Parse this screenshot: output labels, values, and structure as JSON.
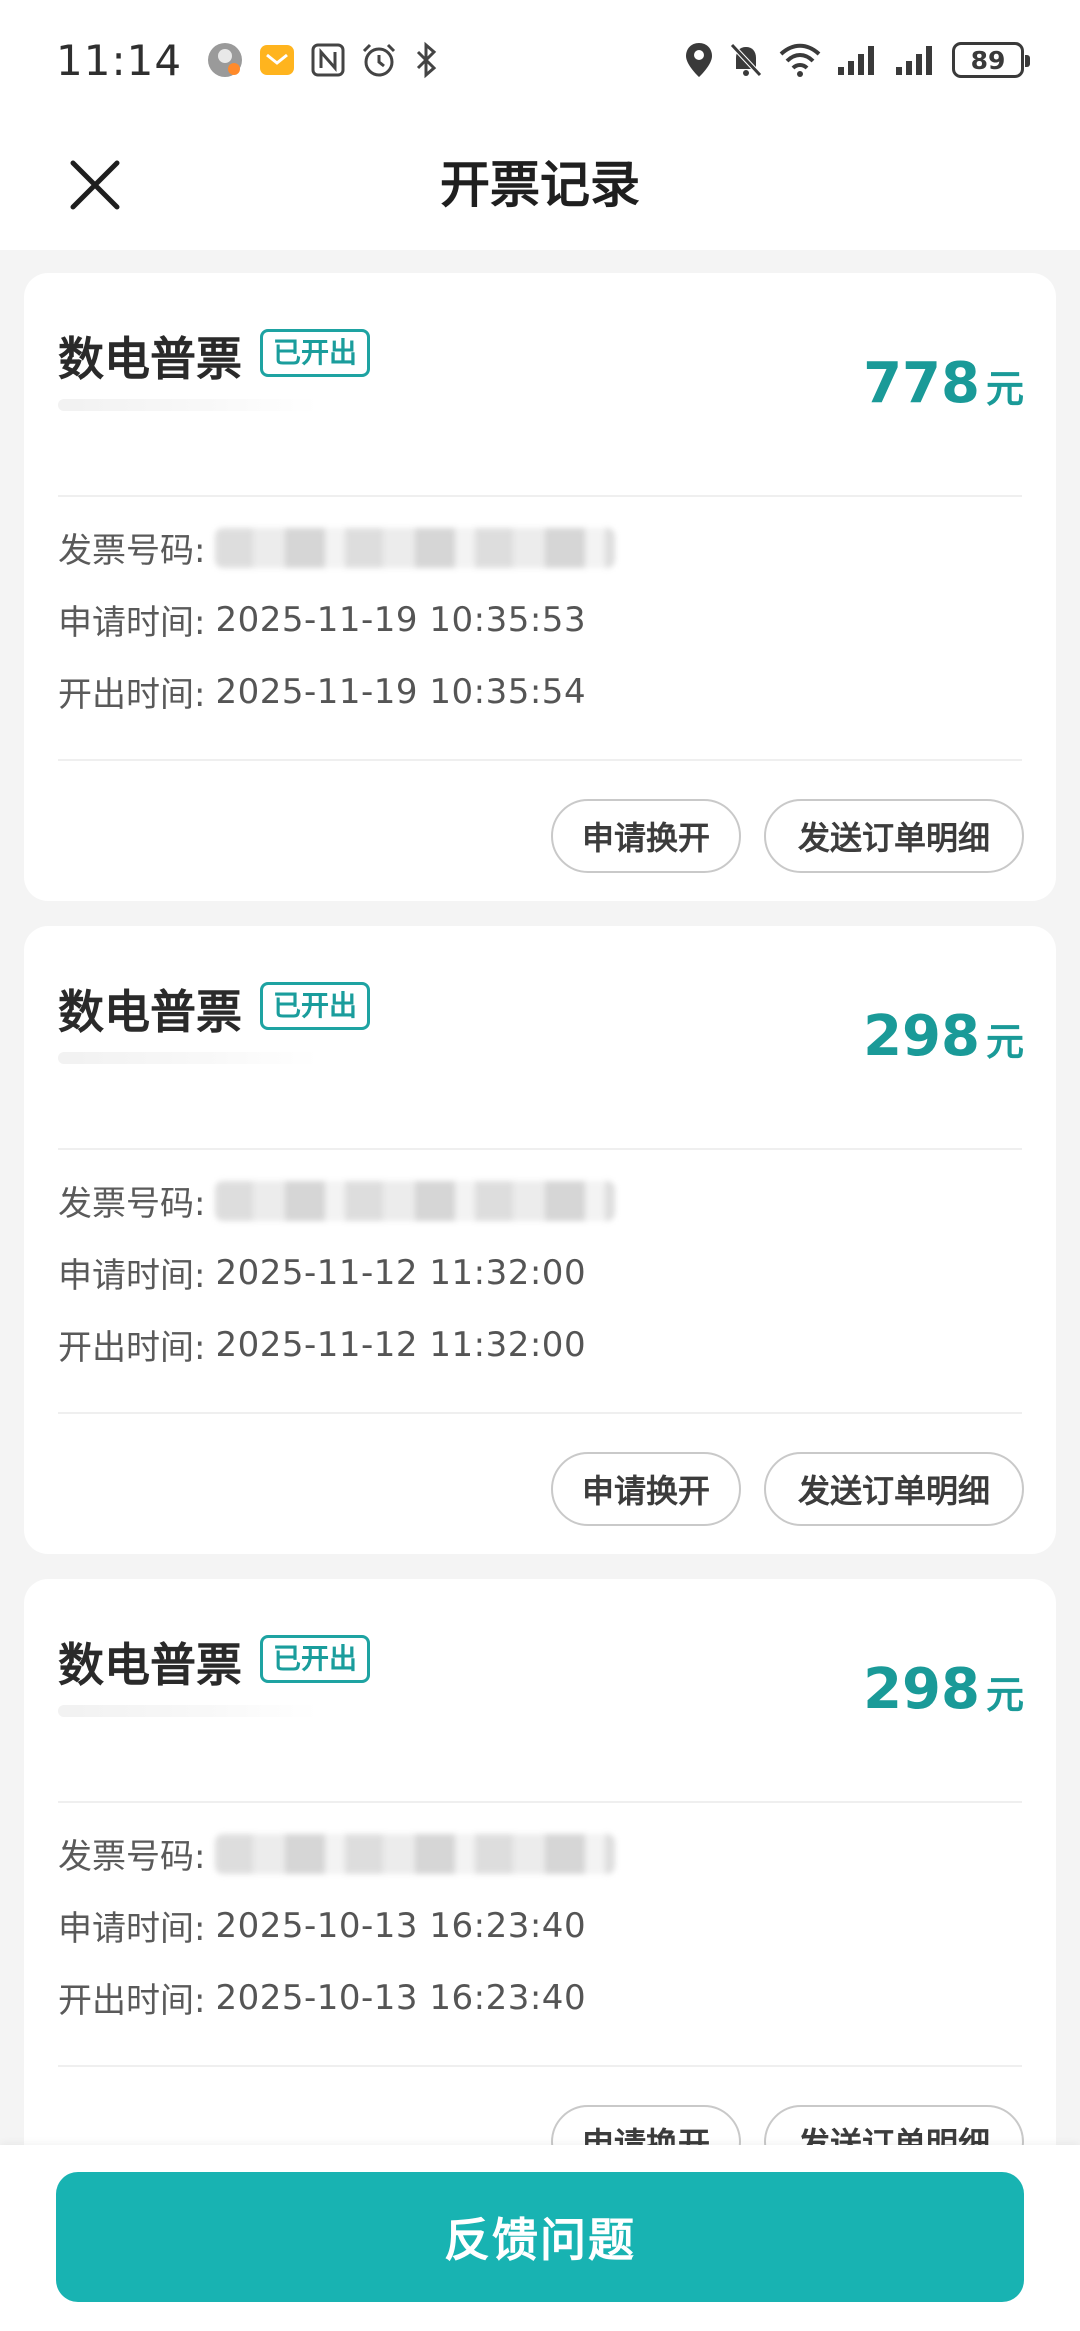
{
  "status_bar": {
    "time": "11:14",
    "battery": "89",
    "left_icons": [
      "avatar-icon",
      "mail-icon",
      "nfc-icon",
      "alarm-icon",
      "bluetooth-icon"
    ],
    "right_icons": [
      "location-icon",
      "bell-off-icon",
      "wifi-icon",
      "signal-icon",
      "signal-icon"
    ]
  },
  "header": {
    "title": "开票记录",
    "close_icon": "close-icon"
  },
  "labels": {
    "invoice_no": "发票号码:",
    "apply_time": "申请时间:",
    "issue_time": "开出时间:",
    "exchange_button": "申请换开",
    "send_button": "发送订单明细",
    "unit": "元"
  },
  "invoices": [
    {
      "type": "数电普票",
      "status": "已开出",
      "amount": "778",
      "apply_time": "2025-11-19 10:35:53",
      "issue_time": "2025-11-19 10:35:54"
    },
    {
      "type": "数电普票",
      "status": "已开出",
      "amount": "298",
      "apply_time": "2025-11-12 11:32:00",
      "issue_time": "2025-11-12 11:32:00"
    },
    {
      "type": "数电普票",
      "status": "已开出",
      "amount": "298",
      "apply_time": "2025-10-13 16:23:40",
      "issue_time": "2025-10-13 16:23:40"
    }
  ],
  "bottom": {
    "feedback_label": "反馈问题"
  },
  "colors": {
    "accent": "#18b3b2",
    "amount": "#1a9a98"
  }
}
